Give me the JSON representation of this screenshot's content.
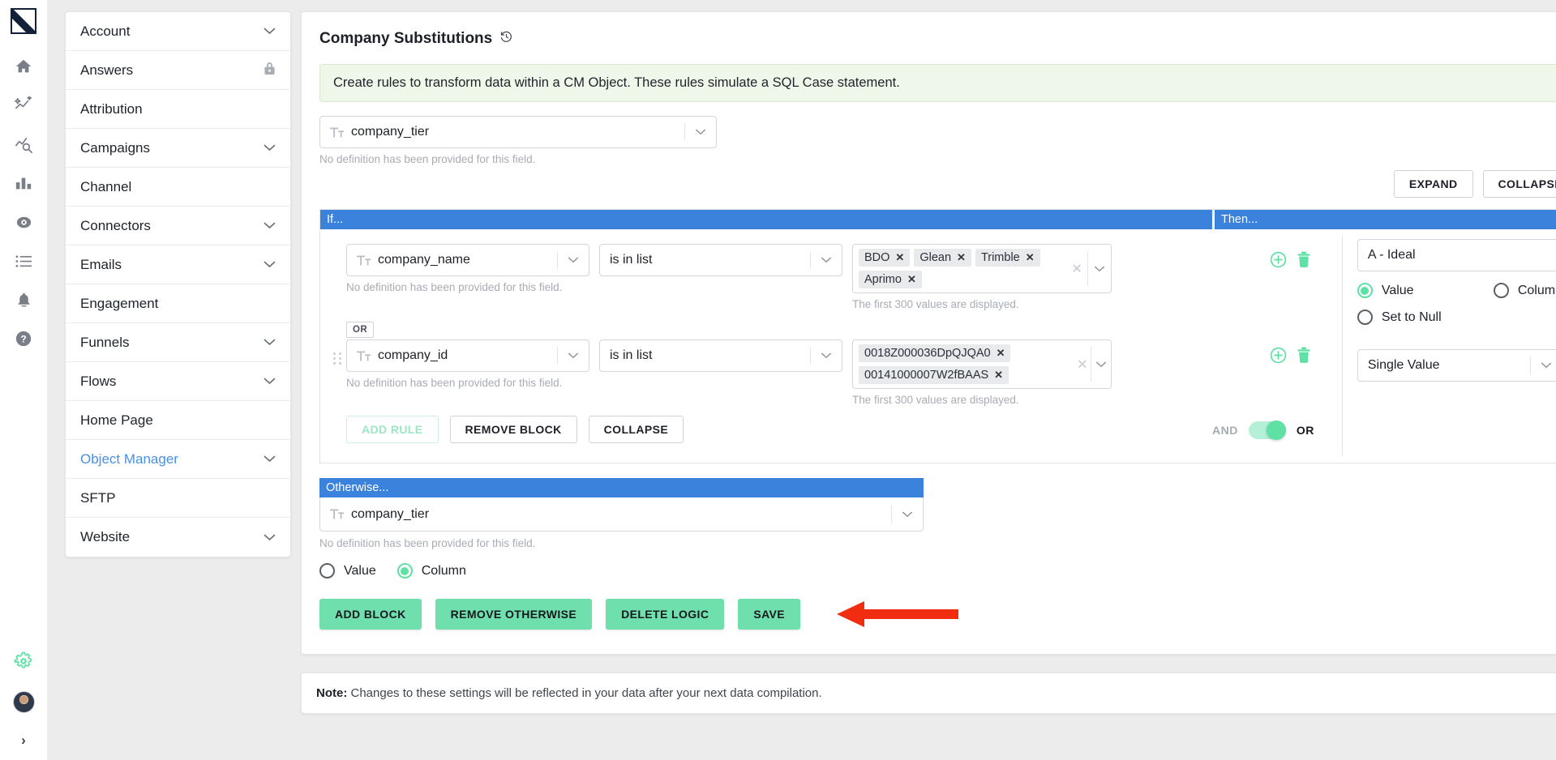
{
  "rail": {
    "logo": "app-logo",
    "items": [
      {
        "name": "home-icon",
        "label": "Home"
      },
      {
        "name": "insights-icon",
        "label": "Insights"
      },
      {
        "name": "analyze-icon",
        "label": "Analyze"
      },
      {
        "name": "reports-icon",
        "label": "Reports"
      },
      {
        "name": "discover-icon",
        "label": "Discover"
      },
      {
        "name": "list-icon",
        "label": "Lists"
      },
      {
        "name": "bell-icon",
        "label": "Alerts"
      },
      {
        "name": "help-icon",
        "label": "Help"
      }
    ],
    "gear": "gear-icon",
    "avatar": "user-avatar",
    "expand": "›"
  },
  "sidebar": {
    "items": [
      {
        "label": "Account",
        "caret": true,
        "lock": false,
        "active": false
      },
      {
        "label": "Answers",
        "caret": false,
        "lock": true,
        "active": false
      },
      {
        "label": "Attribution",
        "caret": false,
        "lock": false,
        "active": false
      },
      {
        "label": "Campaigns",
        "caret": true,
        "lock": false,
        "active": false
      },
      {
        "label": "Channel",
        "caret": false,
        "lock": false,
        "active": false
      },
      {
        "label": "Connectors",
        "caret": true,
        "lock": false,
        "active": false
      },
      {
        "label": "Emails",
        "caret": true,
        "lock": false,
        "active": false
      },
      {
        "label": "Engagement",
        "caret": false,
        "lock": false,
        "active": false
      },
      {
        "label": "Funnels",
        "caret": true,
        "lock": false,
        "active": false
      },
      {
        "label": "Flows",
        "caret": true,
        "lock": false,
        "active": false
      },
      {
        "label": "Home Page",
        "caret": false,
        "lock": false,
        "active": false
      },
      {
        "label": "Object Manager",
        "caret": true,
        "lock": false,
        "active": true
      },
      {
        "label": "SFTP",
        "caret": false,
        "lock": false,
        "active": false
      },
      {
        "label": "Website",
        "caret": true,
        "lock": false,
        "active": false
      }
    ]
  },
  "main": {
    "title": "Company Substitutions",
    "history_icon": "history-icon",
    "info_banner": "Create rules to transform data within a CM Object. These rules simulate a SQL Case statement.",
    "target_field": {
      "value": "company_tier",
      "type_icon": "text-type-icon",
      "hint": "No definition has been provided for this field."
    },
    "expand_label": "EXPAND",
    "collapse_label": "COLLAPSE",
    "block": {
      "if_label": "If...",
      "then_label": "Then...",
      "rules": [
        {
          "field": "company_name",
          "field_hint": "No definition has been provided for this field.",
          "operator": "is in list",
          "values": [
            "BDO",
            "Glean",
            "Trimble",
            "Aprimo"
          ],
          "values_note": "The first 300 values are displayed.",
          "add_icon": "plus-circle-icon",
          "delete_icon": "trash-icon"
        },
        {
          "field": "company_id",
          "field_hint": "No definition has been provided for this field.",
          "operator": "is in list",
          "values": [
            "0018Z000036DpQJQA0",
            "00141000007W2fBAAS"
          ],
          "values_note": "The first 300 values are displayed.",
          "add_icon": "plus-circle-icon",
          "delete_icon": "trash-icon"
        }
      ],
      "joiner_badge": "OR",
      "add_rule_label": "ADD RULE",
      "remove_block_label": "REMOVE BLOCK",
      "collapse_label": "COLLAPSE",
      "and_label": "AND",
      "or_label": "OR",
      "toggle_state": "or",
      "then": {
        "value": "A - Ideal",
        "mode_options": [
          {
            "label": "Value",
            "selected": true
          },
          {
            "label": "Column",
            "selected": false
          },
          {
            "label": "Set to Null",
            "selected": false
          }
        ],
        "value_type": "Single Value"
      }
    },
    "otherwise": {
      "header": "Otherwise...",
      "field": "company_tier",
      "field_hint": "No definition has been provided for this field.",
      "mode_options": [
        {
          "label": "Value",
          "selected": false
        },
        {
          "label": "Column",
          "selected": true
        }
      ]
    },
    "actions": [
      {
        "label": "ADD BLOCK",
        "name": "add-block-button"
      },
      {
        "label": "REMOVE OTHERWISE",
        "name": "remove-otherwise-button"
      },
      {
        "label": "DELETE LOGIC",
        "name": "delete-logic-button"
      },
      {
        "label": "SAVE",
        "name": "save-button"
      }
    ],
    "annotation_arrow": {
      "color": "#f02d10",
      "points_to": "SAVE"
    },
    "note_prefix": "Note:",
    "note_text": " Changes to these settings will be reflected in your data after your next data compilation."
  },
  "colors": {
    "accent_green": "#6fdfae",
    "bar_blue": "#3b82dc",
    "link_blue": "#4a90e2",
    "banner_green_bg": "#eef7ea",
    "arrow_red": "#f02d10"
  }
}
